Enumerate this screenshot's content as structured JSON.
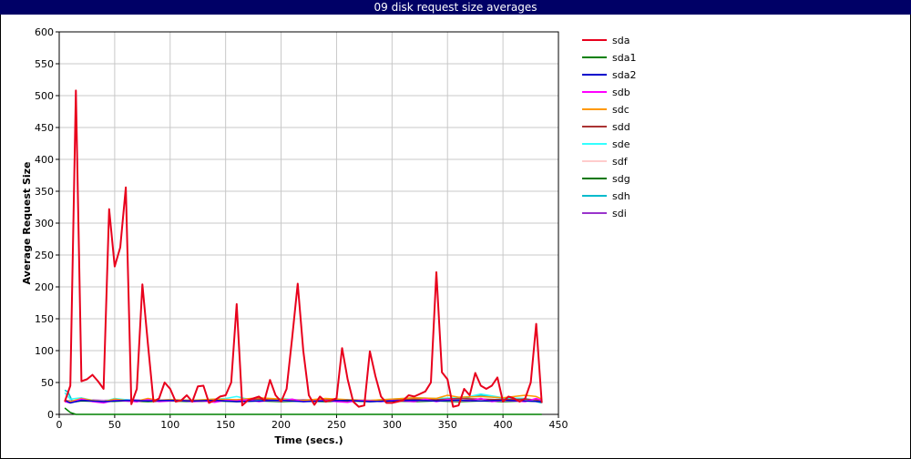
{
  "window": {
    "title": "09 disk request size averages"
  },
  "chart_data": {
    "type": "line",
    "title": "09 disk request size averages",
    "xlabel": "Time (secs.)",
    "ylabel": "Average Request Size",
    "xlim": [
      0,
      450
    ],
    "ylim": [
      0,
      600
    ],
    "x_ticks": [
      0,
      50,
      100,
      150,
      200,
      250,
      300,
      350,
      400,
      450
    ],
    "y_ticks": [
      0,
      50,
      100,
      150,
      200,
      250,
      300,
      350,
      400,
      450,
      500,
      550,
      600
    ],
    "grid": true,
    "legend_position": "right",
    "series": [
      {
        "name": "sda",
        "color": "#e8001c",
        "x": [
          5,
          10,
          15,
          20,
          25,
          30,
          35,
          40,
          45,
          50,
          55,
          60,
          65,
          70,
          75,
          80,
          85,
          90,
          95,
          100,
          105,
          110,
          115,
          120,
          125,
          130,
          135,
          140,
          145,
          150,
          155,
          160,
          165,
          170,
          175,
          180,
          185,
          190,
          195,
          200,
          205,
          210,
          215,
          220,
          225,
          230,
          235,
          240,
          245,
          250,
          255,
          260,
          265,
          270,
          275,
          280,
          285,
          290,
          295,
          300,
          305,
          310,
          315,
          320,
          325,
          330,
          335,
          340,
          345,
          350,
          355,
          360,
          365,
          370,
          375,
          380,
          385,
          390,
          395,
          400,
          405,
          410,
          415,
          420,
          425,
          430,
          435
        ],
        "y": [
          20,
          45,
          508,
          52,
          55,
          62,
          52,
          40,
          322,
          232,
          262,
          356,
          16,
          40,
          204,
          110,
          20,
          25,
          50,
          40,
          20,
          22,
          30,
          20,
          44,
          45,
          18,
          22,
          28,
          30,
          50,
          173,
          14,
          22,
          25,
          28,
          22,
          54,
          30,
          20,
          40,
          120,
          205,
          100,
          30,
          15,
          28,
          20,
          22,
          25,
          104,
          55,
          20,
          12,
          14,
          99,
          60,
          28,
          18,
          18,
          20,
          22,
          30,
          28,
          32,
          36,
          50,
          223,
          66,
          55,
          12,
          14,
          40,
          30,
          65,
          45,
          40,
          45,
          58,
          20,
          28,
          25,
          20,
          25,
          50,
          142,
          18
        ]
      },
      {
        "name": "sda1",
        "color": "#008000",
        "x": [
          5,
          10,
          15,
          50,
          100,
          150,
          200,
          250,
          300,
          350,
          400,
          435
        ],
        "y": [
          10,
          3,
          0,
          0,
          0,
          0,
          0,
          0,
          0,
          0,
          0,
          0
        ]
      },
      {
        "name": "sda2",
        "color": "#0000cc",
        "x": [
          5,
          10,
          20,
          40,
          60,
          80,
          100,
          120,
          140,
          160,
          180,
          200,
          220,
          240,
          260,
          280,
          300,
          320,
          340,
          360,
          380,
          400,
          420,
          435
        ],
        "y": [
          22,
          18,
          22,
          20,
          22,
          21,
          22,
          21,
          22,
          20,
          21,
          22,
          20,
          21,
          22,
          20,
          21,
          22,
          21,
          22,
          21,
          22,
          21,
          20
        ]
      },
      {
        "name": "sdb",
        "color": "#ff00ff",
        "x": [
          5,
          10,
          20,
          30,
          40,
          50,
          60,
          70,
          80,
          90,
          100,
          110,
          120,
          130,
          140,
          150,
          160,
          170,
          180,
          190,
          200,
          210,
          220,
          230,
          240,
          250,
          260,
          270,
          280,
          290,
          300,
          310,
          320,
          330,
          340,
          350,
          360,
          370,
          380,
          390,
          400,
          410,
          420,
          430,
          435
        ],
        "y": [
          20,
          18,
          24,
          20,
          18,
          22,
          21,
          20,
          23,
          20,
          21,
          22,
          20,
          21,
          19,
          22,
          21,
          23,
          20,
          22,
          21,
          24,
          20,
          21,
          22,
          20,
          19,
          22,
          21,
          20,
          22,
          21,
          20,
          24,
          20,
          23,
          22,
          21,
          25,
          20,
          22,
          21,
          20,
          25,
          22
        ]
      },
      {
        "name": "sdc",
        "color": "#ff9900",
        "x": [
          5,
          10,
          20,
          30,
          40,
          50,
          60,
          70,
          80,
          90,
          100,
          120,
          140,
          160,
          180,
          200,
          220,
          240,
          260,
          280,
          300,
          320,
          340,
          350,
          360,
          380,
          400,
          420,
          430,
          435
        ],
        "y": [
          22,
          20,
          25,
          22,
          20,
          24,
          22,
          21,
          25,
          22,
          23,
          22,
          24,
          23,
          26,
          24,
          22,
          25,
          23,
          22,
          24,
          26,
          25,
          30,
          27,
          28,
          26,
          30,
          28,
          24
        ]
      },
      {
        "name": "sdd",
        "color": "#aa3333",
        "x": [
          5,
          10,
          20,
          30,
          40,
          50,
          60,
          70,
          80,
          90,
          100,
          120,
          140,
          160,
          180,
          200,
          220,
          240,
          260,
          280,
          300,
          320,
          340,
          360,
          380,
          400,
          420,
          435
        ],
        "y": [
          21,
          19,
          23,
          21,
          19,
          22,
          21,
          20,
          22,
          21,
          22,
          21,
          23,
          22,
          24,
          22,
          21,
          23,
          22,
          21,
          23,
          24,
          23,
          25,
          24,
          23,
          24,
          22
        ]
      },
      {
        "name": "sde",
        "color": "#33ffff",
        "x": [
          5,
          10,
          20,
          30,
          40,
          50,
          60,
          70,
          80,
          90,
          100,
          120,
          140,
          150,
          160,
          170,
          180,
          200,
          220,
          240,
          260,
          280,
          300,
          320,
          340,
          360,
          370,
          380,
          400,
          420,
          435
        ],
        "y": [
          34,
          24,
          26,
          22,
          20,
          25,
          23,
          21,
          24,
          22,
          23,
          22,
          24,
          25,
          28,
          24,
          23,
          25,
          22,
          24,
          23,
          22,
          24,
          26,
          25,
          26,
          28,
          32,
          26,
          25,
          20
        ]
      },
      {
        "name": "sdf",
        "color": "#ffcccc",
        "x": [
          5,
          10,
          20,
          40,
          60,
          80,
          100,
          120,
          140,
          160,
          180,
          200,
          220,
          240,
          260,
          280,
          300,
          320,
          340,
          360,
          380,
          400,
          420,
          435
        ],
        "y": [
          21,
          20,
          22,
          21,
          22,
          21,
          22,
          21,
          22,
          21,
          22,
          21,
          22,
          21,
          22,
          21,
          22,
          21,
          22,
          21,
          22,
          21,
          22,
          21
        ]
      },
      {
        "name": "sdg",
        "color": "#007700",
        "x": [
          5,
          10,
          20,
          40,
          60,
          80,
          100,
          120,
          140,
          160,
          180,
          200,
          220,
          240,
          260,
          280,
          300,
          320,
          340,
          360,
          380,
          400,
          420,
          435
        ],
        "y": [
          20,
          19,
          21,
          20,
          21,
          20,
          21,
          20,
          21,
          20,
          21,
          20,
          21,
          20,
          21,
          20,
          21,
          20,
          21,
          20,
          21,
          20,
          21,
          20
        ]
      },
      {
        "name": "sdh",
        "color": "#00bbcc",
        "x": [
          5,
          8,
          12,
          20,
          30,
          40,
          50,
          60,
          70,
          80,
          90,
          100,
          120,
          140,
          160,
          180,
          200,
          220,
          240,
          260,
          280,
          300,
          320,
          340,
          360,
          380,
          400,
          420,
          435
        ],
        "y": [
          38,
          35,
          20,
          24,
          22,
          19,
          23,
          22,
          20,
          23,
          21,
          22,
          21,
          23,
          22,
          24,
          22,
          21,
          23,
          22,
          21,
          23,
          24,
          23,
          24,
          30,
          25,
          24,
          18
        ]
      },
      {
        "name": "sdi",
        "color": "#9933cc",
        "x": [
          5,
          10,
          20,
          40,
          60,
          80,
          100,
          120,
          140,
          160,
          180,
          200,
          220,
          240,
          260,
          280,
          300,
          320,
          340,
          360,
          380,
          400,
          420,
          435
        ],
        "y": [
          22,
          21,
          23,
          22,
          23,
          22,
          23,
          22,
          23,
          22,
          23,
          22,
          23,
          22,
          23,
          22,
          23,
          22,
          23,
          22,
          23,
          22,
          23,
          21
        ]
      }
    ]
  }
}
